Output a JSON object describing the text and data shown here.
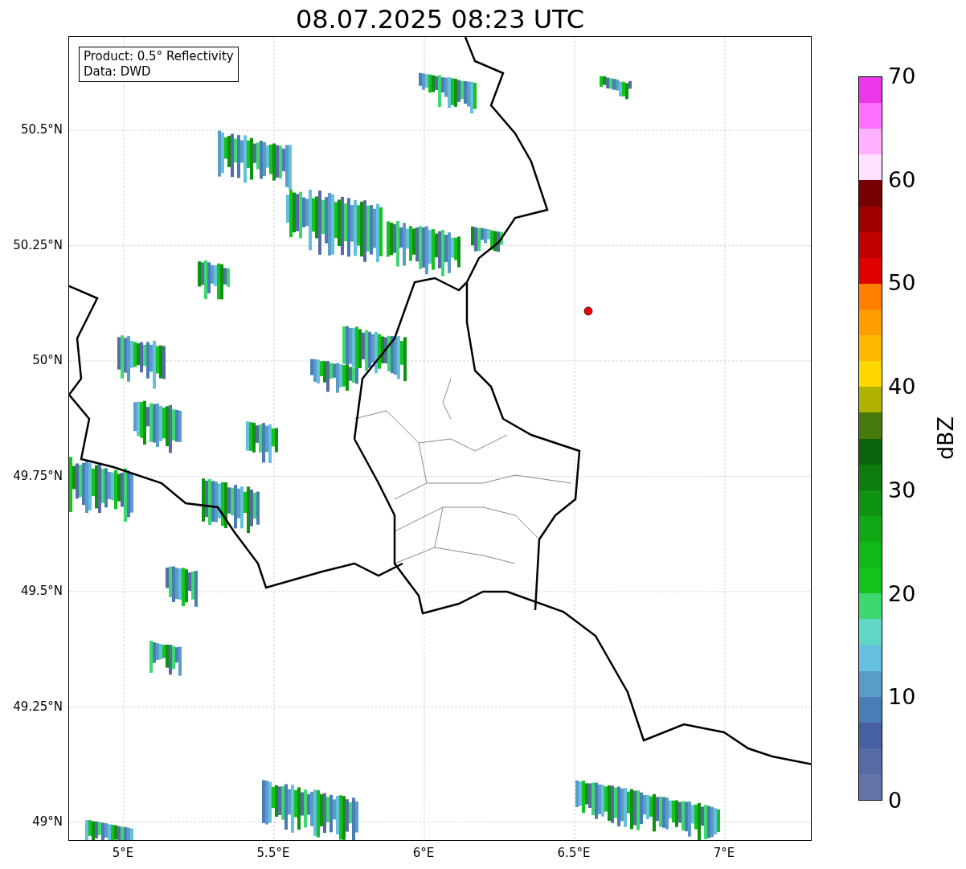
{
  "title": "08.07.2025 08:23 UTC",
  "map": {
    "info_lines": [
      "Product: 0.5° Reflectivity",
      "Data: DWD"
    ],
    "yticks": [
      "50.5°N",
      "50.25°N",
      "50°N",
      "49.75°N",
      "49.5°N",
      "49.25°N",
      "49°N"
    ],
    "xticks": [
      "5°E",
      "5.5°E",
      "6°E",
      "6.5°E",
      "7°E"
    ]
  },
  "colorbar": {
    "label": "dBZ",
    "ticks": [
      "70",
      "60",
      "50",
      "40",
      "30",
      "20",
      "10",
      "0"
    ],
    "bands": [
      {
        "color": "#ea38ea"
      },
      {
        "color": "#ff70ff"
      },
      {
        "color": "#ffb0ff"
      },
      {
        "color": "#ffe0ff"
      },
      {
        "color": "#780000"
      },
      {
        "color": "#a00000"
      },
      {
        "color": "#c00000"
      },
      {
        "color": "#e00000"
      },
      {
        "color": "#ff8000"
      },
      {
        "color": "#ff9c00"
      },
      {
        "color": "#ffb800"
      },
      {
        "color": "#ffd800"
      },
      {
        "color": "#b0b200"
      },
      {
        "color": "#467a0c"
      },
      {
        "color": "#0a620c"
      },
      {
        "color": "#0e7d10"
      },
      {
        "color": "#0e9212"
      },
      {
        "color": "#10a814"
      },
      {
        "color": "#12b818"
      },
      {
        "color": "#14c41c"
      },
      {
        "color": "#3ed870"
      },
      {
        "color": "#60d6c4"
      },
      {
        "color": "#64c0dc"
      },
      {
        "color": "#5a9cc8"
      },
      {
        "color": "#4a7db6"
      },
      {
        "color": "#4660a2"
      },
      {
        "color": "#566aa3"
      },
      {
        "color": "#6375a8"
      }
    ]
  }
}
